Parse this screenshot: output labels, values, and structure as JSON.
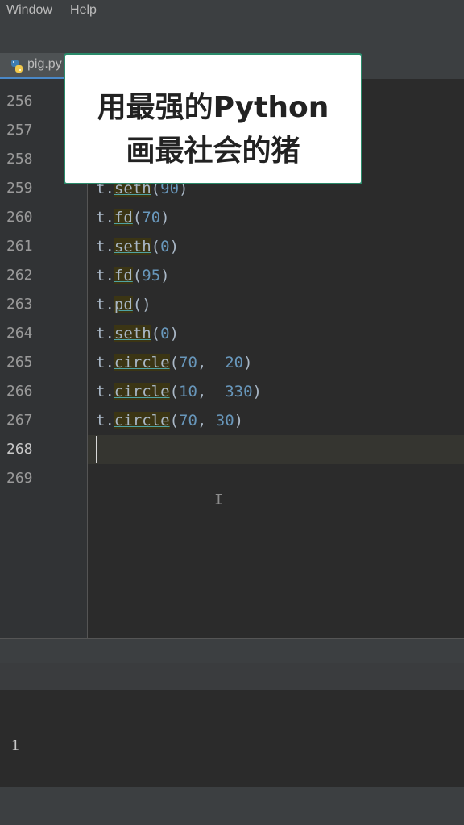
{
  "menu": {
    "window_label": "Window",
    "help_label": "Help"
  },
  "tab": {
    "filename": "pig.py",
    "icon": "python-icon"
  },
  "overlay": {
    "line1": "用最强的Python",
    "line2": "画最社会的猪"
  },
  "editor": {
    "line_numbers": [
      "256",
      "257",
      "258",
      "259",
      "260",
      "261",
      "262",
      "263",
      "264",
      "265",
      "266",
      "267",
      "268",
      "269"
    ],
    "current_line": "268",
    "code": [
      {
        "obj": "t",
        "dot": ".",
        "fn": "seth",
        "open": "(",
        "args": [
          {
            "v": "90"
          }
        ],
        "close": ")"
      },
      {
        "obj": "t",
        "dot": ".",
        "fn": "fd",
        "open": "(",
        "args": [
          {
            "v": "70"
          }
        ],
        "close": ")"
      },
      {
        "obj": "t",
        "dot": ".",
        "fn": "seth",
        "open": "(",
        "args": [
          {
            "v": "0"
          }
        ],
        "close": ")"
      },
      {
        "obj": "t",
        "dot": ".",
        "fn": "fd",
        "open": "(",
        "args": [
          {
            "v": "95"
          }
        ],
        "close": ")"
      },
      {
        "obj": "t",
        "dot": ".",
        "fn": "pd",
        "open": "(",
        "args": [],
        "close": ")"
      },
      {
        "obj": "t",
        "dot": ".",
        "fn": "seth",
        "open": "(",
        "args": [
          {
            "v": "0"
          }
        ],
        "close": ")"
      },
      {
        "obj": "t",
        "dot": ".",
        "fn": "circle",
        "open": "(",
        "args": [
          {
            "v": "70"
          },
          {
            "sep": ",  "
          },
          {
            "v": "20"
          }
        ],
        "close": ")"
      },
      {
        "obj": "t",
        "dot": ".",
        "fn": "circle",
        "open": "(",
        "args": [
          {
            "v": "10"
          },
          {
            "sep": ",  "
          },
          {
            "v": "330"
          }
        ],
        "close": ")"
      },
      {
        "obj": "t",
        "dot": ".",
        "fn": "circle",
        "open": "(",
        "args": [
          {
            "v": "70"
          },
          {
            "sep": ", "
          },
          {
            "v": "30"
          }
        ],
        "close": ")"
      }
    ]
  },
  "console": {
    "output": "1"
  },
  "colors": {
    "accent": "#4a88c7",
    "number": "#6897bb",
    "background": "#2b2b2b",
    "overlay_border": "#2a8a6a"
  }
}
